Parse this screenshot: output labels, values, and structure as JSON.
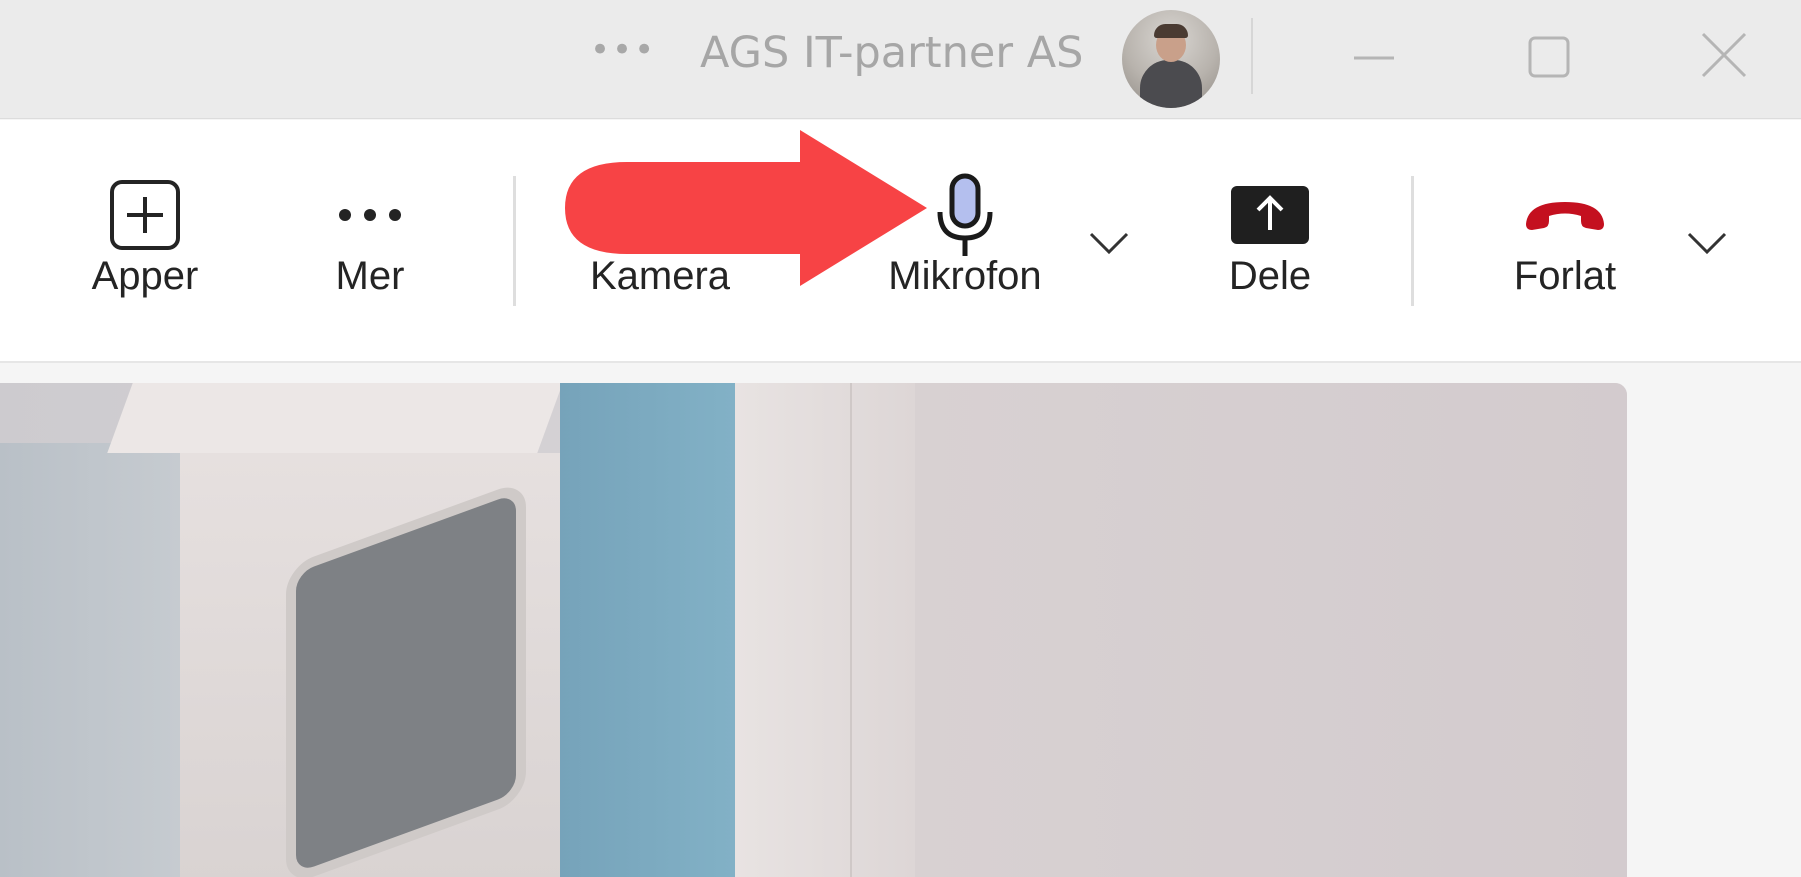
{
  "titlebar": {
    "more_label": "•••",
    "org_name": "AGS IT-partner AS"
  },
  "toolbar": {
    "apps_label": "Apper",
    "more_label": "Mer",
    "camera_label": "Kamera",
    "mic_label": "Mikrofon",
    "share_label": "Dele",
    "leave_label": "Forlat"
  },
  "colors": {
    "annotation_arrow": "#f74345",
    "leave_icon": "#c4101f",
    "mic_fill": "#b4bfee"
  }
}
